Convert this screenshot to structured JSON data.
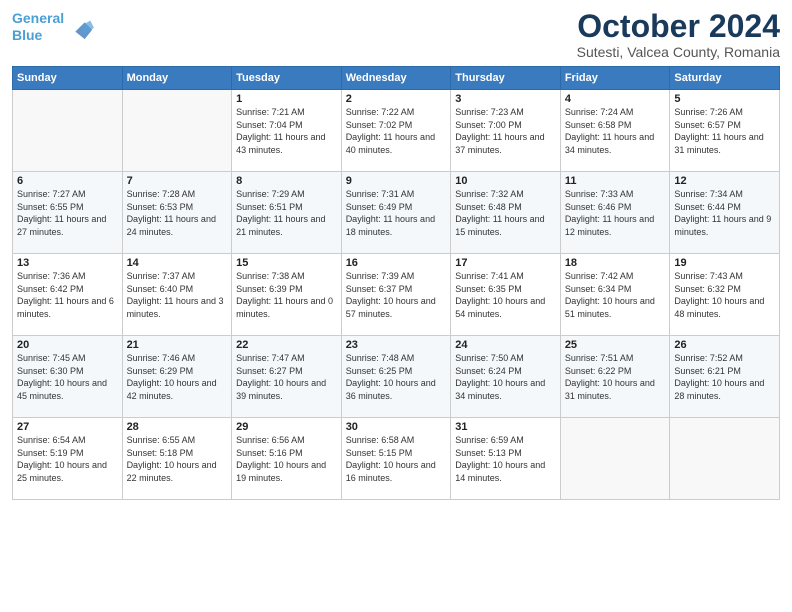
{
  "header": {
    "logo_line1": "General",
    "logo_line2": "Blue",
    "month": "October 2024",
    "location": "Sutesti, Valcea County, Romania"
  },
  "days_of_week": [
    "Sunday",
    "Monday",
    "Tuesday",
    "Wednesday",
    "Thursday",
    "Friday",
    "Saturday"
  ],
  "weeks": [
    [
      {
        "day": "",
        "info": ""
      },
      {
        "day": "",
        "info": ""
      },
      {
        "day": "1",
        "info": "Sunrise: 7:21 AM\nSunset: 7:04 PM\nDaylight: 11 hours and 43 minutes."
      },
      {
        "day": "2",
        "info": "Sunrise: 7:22 AM\nSunset: 7:02 PM\nDaylight: 11 hours and 40 minutes."
      },
      {
        "day": "3",
        "info": "Sunrise: 7:23 AM\nSunset: 7:00 PM\nDaylight: 11 hours and 37 minutes."
      },
      {
        "day": "4",
        "info": "Sunrise: 7:24 AM\nSunset: 6:58 PM\nDaylight: 11 hours and 34 minutes."
      },
      {
        "day": "5",
        "info": "Sunrise: 7:26 AM\nSunset: 6:57 PM\nDaylight: 11 hours and 31 minutes."
      }
    ],
    [
      {
        "day": "6",
        "info": "Sunrise: 7:27 AM\nSunset: 6:55 PM\nDaylight: 11 hours and 27 minutes."
      },
      {
        "day": "7",
        "info": "Sunrise: 7:28 AM\nSunset: 6:53 PM\nDaylight: 11 hours and 24 minutes."
      },
      {
        "day": "8",
        "info": "Sunrise: 7:29 AM\nSunset: 6:51 PM\nDaylight: 11 hours and 21 minutes."
      },
      {
        "day": "9",
        "info": "Sunrise: 7:31 AM\nSunset: 6:49 PM\nDaylight: 11 hours and 18 minutes."
      },
      {
        "day": "10",
        "info": "Sunrise: 7:32 AM\nSunset: 6:48 PM\nDaylight: 11 hours and 15 minutes."
      },
      {
        "day": "11",
        "info": "Sunrise: 7:33 AM\nSunset: 6:46 PM\nDaylight: 11 hours and 12 minutes."
      },
      {
        "day": "12",
        "info": "Sunrise: 7:34 AM\nSunset: 6:44 PM\nDaylight: 11 hours and 9 minutes."
      }
    ],
    [
      {
        "day": "13",
        "info": "Sunrise: 7:36 AM\nSunset: 6:42 PM\nDaylight: 11 hours and 6 minutes."
      },
      {
        "day": "14",
        "info": "Sunrise: 7:37 AM\nSunset: 6:40 PM\nDaylight: 11 hours and 3 minutes."
      },
      {
        "day": "15",
        "info": "Sunrise: 7:38 AM\nSunset: 6:39 PM\nDaylight: 11 hours and 0 minutes."
      },
      {
        "day": "16",
        "info": "Sunrise: 7:39 AM\nSunset: 6:37 PM\nDaylight: 10 hours and 57 minutes."
      },
      {
        "day": "17",
        "info": "Sunrise: 7:41 AM\nSunset: 6:35 PM\nDaylight: 10 hours and 54 minutes."
      },
      {
        "day": "18",
        "info": "Sunrise: 7:42 AM\nSunset: 6:34 PM\nDaylight: 10 hours and 51 minutes."
      },
      {
        "day": "19",
        "info": "Sunrise: 7:43 AM\nSunset: 6:32 PM\nDaylight: 10 hours and 48 minutes."
      }
    ],
    [
      {
        "day": "20",
        "info": "Sunrise: 7:45 AM\nSunset: 6:30 PM\nDaylight: 10 hours and 45 minutes."
      },
      {
        "day": "21",
        "info": "Sunrise: 7:46 AM\nSunset: 6:29 PM\nDaylight: 10 hours and 42 minutes."
      },
      {
        "day": "22",
        "info": "Sunrise: 7:47 AM\nSunset: 6:27 PM\nDaylight: 10 hours and 39 minutes."
      },
      {
        "day": "23",
        "info": "Sunrise: 7:48 AM\nSunset: 6:25 PM\nDaylight: 10 hours and 36 minutes."
      },
      {
        "day": "24",
        "info": "Sunrise: 7:50 AM\nSunset: 6:24 PM\nDaylight: 10 hours and 34 minutes."
      },
      {
        "day": "25",
        "info": "Sunrise: 7:51 AM\nSunset: 6:22 PM\nDaylight: 10 hours and 31 minutes."
      },
      {
        "day": "26",
        "info": "Sunrise: 7:52 AM\nSunset: 6:21 PM\nDaylight: 10 hours and 28 minutes."
      }
    ],
    [
      {
        "day": "27",
        "info": "Sunrise: 6:54 AM\nSunset: 5:19 PM\nDaylight: 10 hours and 25 minutes."
      },
      {
        "day": "28",
        "info": "Sunrise: 6:55 AM\nSunset: 5:18 PM\nDaylight: 10 hours and 22 minutes."
      },
      {
        "day": "29",
        "info": "Sunrise: 6:56 AM\nSunset: 5:16 PM\nDaylight: 10 hours and 19 minutes."
      },
      {
        "day": "30",
        "info": "Sunrise: 6:58 AM\nSunset: 5:15 PM\nDaylight: 10 hours and 16 minutes."
      },
      {
        "day": "31",
        "info": "Sunrise: 6:59 AM\nSunset: 5:13 PM\nDaylight: 10 hours and 14 minutes."
      },
      {
        "day": "",
        "info": ""
      },
      {
        "day": "",
        "info": ""
      }
    ]
  ]
}
